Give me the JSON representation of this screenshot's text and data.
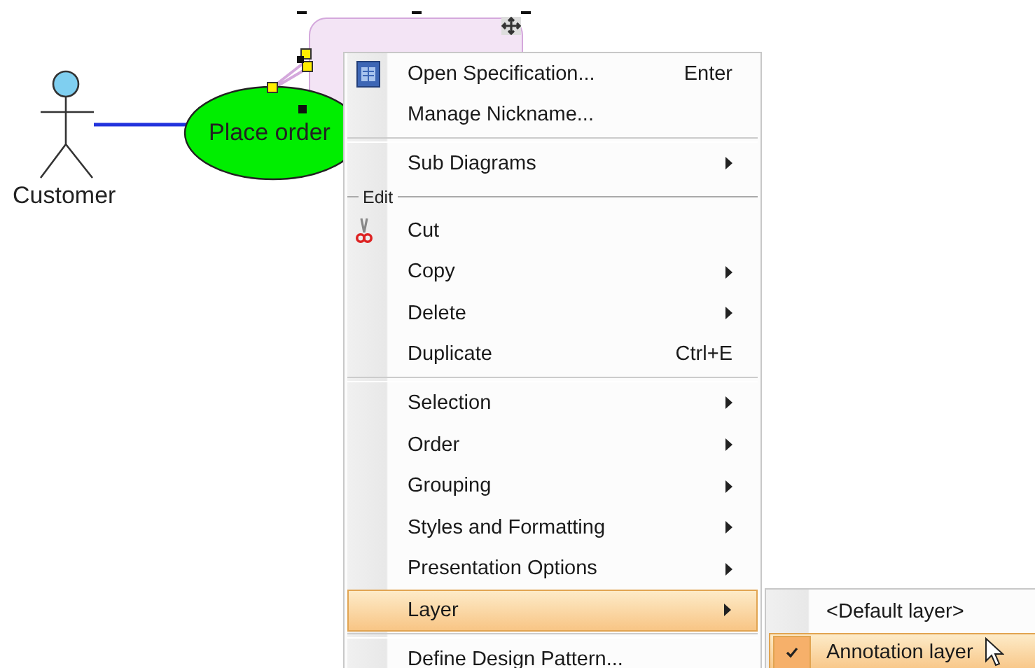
{
  "diagram": {
    "actor": {
      "name": "Customer"
    },
    "use_case": {
      "name": "Place order"
    }
  },
  "context_menu": {
    "items": [
      {
        "kind": "item",
        "label": "Open Specification...",
        "shortcut": "Enter",
        "submenu": false,
        "selected": false
      },
      {
        "kind": "item",
        "label": "Manage Nickname...",
        "submenu": false,
        "selected": false
      },
      {
        "kind": "separator"
      },
      {
        "kind": "item",
        "label": "Sub Diagrams",
        "submenu": true,
        "selected": false
      },
      {
        "kind": "group",
        "label": "Edit"
      },
      {
        "kind": "item",
        "label": "Cut",
        "submenu": false,
        "selected": false
      },
      {
        "kind": "item",
        "label": "Copy",
        "submenu": true,
        "selected": false
      },
      {
        "kind": "item",
        "label": "Delete",
        "submenu": true,
        "selected": false
      },
      {
        "kind": "item",
        "label": "Duplicate",
        "shortcut": "Ctrl+E",
        "submenu": false,
        "selected": false
      },
      {
        "kind": "separator"
      },
      {
        "kind": "item",
        "label": "Selection",
        "submenu": true,
        "selected": false
      },
      {
        "kind": "item",
        "label": "Order",
        "submenu": true,
        "selected": false
      },
      {
        "kind": "item",
        "label": "Grouping",
        "submenu": true,
        "selected": false
      },
      {
        "kind": "item",
        "label": "Styles and Formatting",
        "submenu": true,
        "selected": false
      },
      {
        "kind": "item",
        "label": "Presentation Options",
        "submenu": true,
        "selected": false
      },
      {
        "kind": "item",
        "label": "Layer",
        "submenu": true,
        "selected": true
      },
      {
        "kind": "separator"
      },
      {
        "kind": "item",
        "label": "Define Design Pattern...",
        "submenu": false,
        "selected": false
      }
    ]
  },
  "submenu": {
    "items": [
      {
        "label": "<Default layer>",
        "checked": false,
        "selected": false
      },
      {
        "label": "Annotation layer",
        "checked": true,
        "selected": true
      }
    ]
  }
}
